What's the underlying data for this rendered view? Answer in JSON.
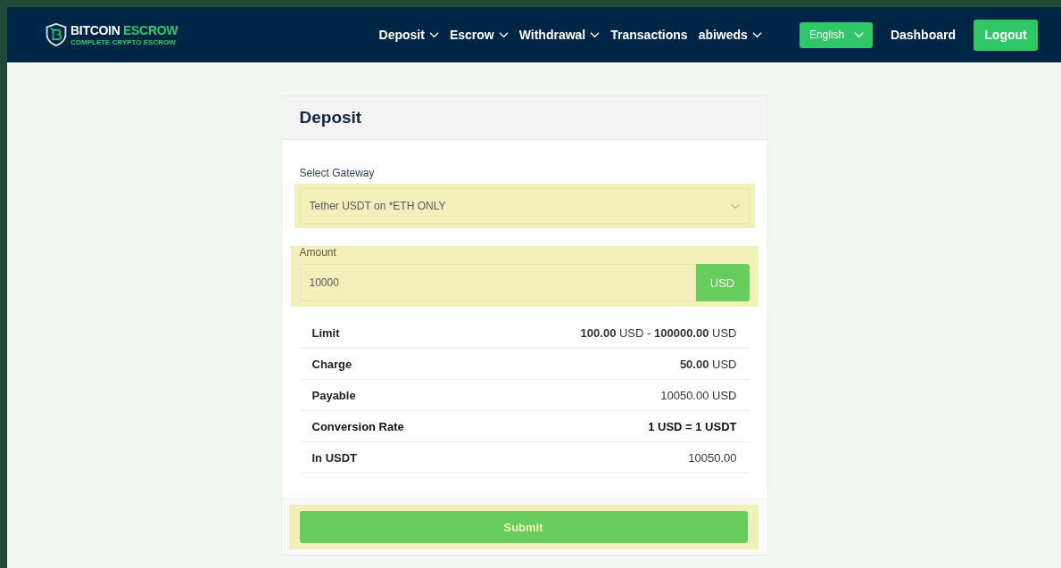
{
  "brand": {
    "name_first": "BITCOIN",
    "name_second": "ESCROW",
    "tagline": "COMPLETE CRYPTO ESCROW"
  },
  "nav": [
    {
      "label": "Deposit",
      "dropdown": true
    },
    {
      "label": "Escrow",
      "dropdown": true
    },
    {
      "label": "Withdrawal",
      "dropdown": true
    },
    {
      "label": "Transactions",
      "dropdown": false
    },
    {
      "label": "abiweds",
      "dropdown": true
    }
  ],
  "language": {
    "value": "English"
  },
  "actions": [
    {
      "label": "Dashboard",
      "kind": "link"
    },
    {
      "label": "Logout",
      "kind": "button"
    }
  ],
  "card": {
    "title": "Deposit",
    "gateway": {
      "label": "Select Gateway",
      "value": "Tether USDT on *ETH ONLY"
    },
    "amount": {
      "label": "Amount",
      "value": "10000",
      "currency": "USD"
    },
    "rows": [
      {
        "label": "Limit",
        "value": "**100.00** USD - **100000.00** USD",
        "emphasis": false
      },
      {
        "label": "Charge",
        "value": "**50.00** USD",
        "emphasis": false
      },
      {
        "label": "Payable",
        "value": "10050.00 USD",
        "emphasis": false
      },
      {
        "label": "Conversion Rate",
        "value": "1 USD = 1 USDT",
        "emphasis": true
      },
      {
        "label": "In USDT",
        "value": "10050.00",
        "emphasis": false
      }
    ],
    "submit": "Submit"
  }
}
